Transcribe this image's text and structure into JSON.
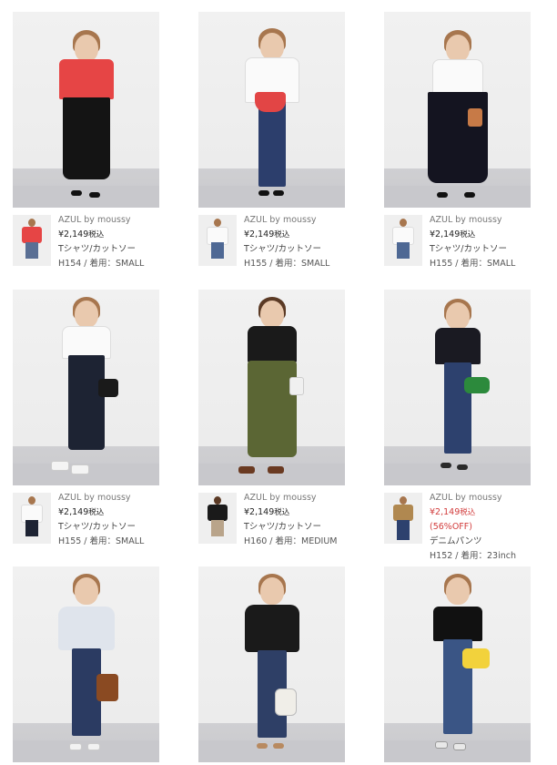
{
  "items": [
    {
      "brand": "AZUL by moussy",
      "price": "¥2,149",
      "tax": "税込",
      "category": "Tシャツ/カットソー",
      "size": "H154 / 着用：SMALL",
      "top_color": "#e64545",
      "bottom_color": "#141414",
      "skirt": true
    },
    {
      "brand": "AZUL by moussy",
      "price": "¥2,149",
      "tax": "税込",
      "category": "Tシャツ/カットソー",
      "size": "H155 / 着用：SMALL",
      "top_color": "#fafafa",
      "bottom_color": "#2c3e6c",
      "skirt": false
    },
    {
      "brand": "AZUL by moussy",
      "price": "¥2,149",
      "tax": "税込",
      "category": "Tシャツ/カットソー",
      "size": "H155 / 着用：SMALL",
      "top_color": "#fafafa",
      "bottom_color": "#141420",
      "skirt": true
    },
    {
      "brand": "AZUL by moussy",
      "price": "¥2,149",
      "tax": "税込",
      "category": "Tシャツ/カットソー",
      "size": "H155 / 着用：SMALL",
      "top_color": "#fafafa",
      "bottom_color": "#1d2333",
      "skirt": true
    },
    {
      "brand": "AZUL by moussy",
      "price": "¥2,149",
      "tax": "税込",
      "category": "Tシャツ/カットソー",
      "size": "H160 / 着用：MEDIUM",
      "top_color": "#1a1a1a",
      "bottom_color": "#5b6634",
      "skirt": true
    },
    {
      "brand": "AZUL by moussy",
      "price": "¥2,149",
      "tax": "税込",
      "discount": "(56%OFF)",
      "category": "デニムパンツ",
      "size": "H152 / 着用：23inch",
      "top_color": "#1a1a22",
      "bottom_color": "#2d416e",
      "skirt": false,
      "sale": true
    },
    {
      "top_color": "#dfe4ec",
      "bottom_color": "#2b3b62",
      "skirt": false
    },
    {
      "top_color": "#1a1a1a",
      "bottom_color": "#2e3f66",
      "skirt": false
    },
    {
      "top_color": "#111111",
      "bottom_color": "#3a5585",
      "skirt": false
    }
  ]
}
